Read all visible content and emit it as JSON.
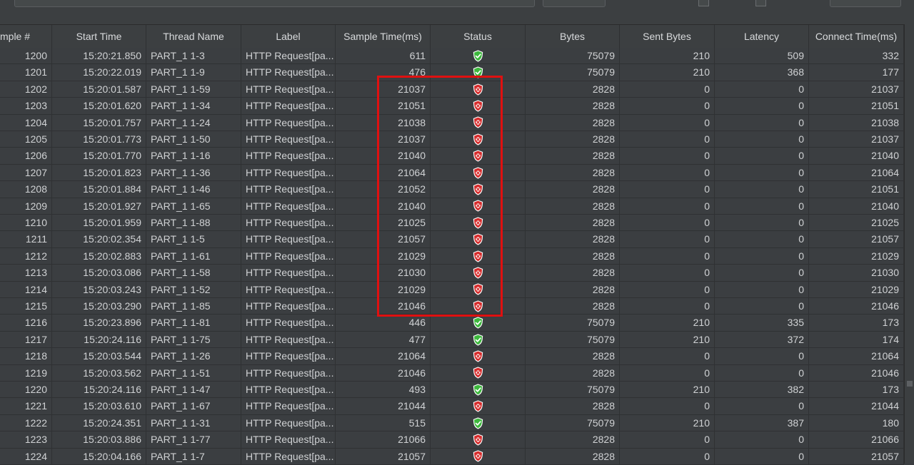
{
  "columns": [
    "mple #",
    "Start Time",
    "Thread Name",
    "Label",
    "Sample Time(ms)",
    "Status",
    "Bytes",
    "Sent Bytes",
    "Latency",
    "Connect Time(ms)"
  ],
  "colors": {
    "success": "#3db83d",
    "error": "#d62b2b",
    "highlight": "#e01010"
  },
  "rows": [
    {
      "sample": "1200",
      "start": "15:20:21.850",
      "thread": "PART_1 1-3",
      "label": "HTTP Request[pa...",
      "time": "611",
      "status": "success",
      "bytes": "75079",
      "sent": "210",
      "latency": "509",
      "connect": "332"
    },
    {
      "sample": "1201",
      "start": "15:20:22.019",
      "thread": "PART_1 1-9",
      "label": "HTTP Request[pa...",
      "time": "476",
      "status": "success",
      "bytes": "75079",
      "sent": "210",
      "latency": "368",
      "connect": "177"
    },
    {
      "sample": "1202",
      "start": "15:20:01.587",
      "thread": "PART_1 1-59",
      "label": "HTTP Request[pa...",
      "time": "21037",
      "status": "error",
      "bytes": "2828",
      "sent": "0",
      "latency": "0",
      "connect": "21037"
    },
    {
      "sample": "1203",
      "start": "15:20:01.620",
      "thread": "PART_1 1-34",
      "label": "HTTP Request[pa...",
      "time": "21051",
      "status": "error",
      "bytes": "2828",
      "sent": "0",
      "latency": "0",
      "connect": "21051"
    },
    {
      "sample": "1204",
      "start": "15:20:01.757",
      "thread": "PART_1 1-24",
      "label": "HTTP Request[pa...",
      "time": "21038",
      "status": "error",
      "bytes": "2828",
      "sent": "0",
      "latency": "0",
      "connect": "21038"
    },
    {
      "sample": "1205",
      "start": "15:20:01.773",
      "thread": "PART_1 1-50",
      "label": "HTTP Request[pa...",
      "time": "21037",
      "status": "error",
      "bytes": "2828",
      "sent": "0",
      "latency": "0",
      "connect": "21037"
    },
    {
      "sample": "1206",
      "start": "15:20:01.770",
      "thread": "PART_1 1-16",
      "label": "HTTP Request[pa...",
      "time": "21040",
      "status": "error",
      "bytes": "2828",
      "sent": "0",
      "latency": "0",
      "connect": "21040"
    },
    {
      "sample": "1207",
      "start": "15:20:01.823",
      "thread": "PART_1 1-36",
      "label": "HTTP Request[pa...",
      "time": "21064",
      "status": "error",
      "bytes": "2828",
      "sent": "0",
      "latency": "0",
      "connect": "21064"
    },
    {
      "sample": "1208",
      "start": "15:20:01.884",
      "thread": "PART_1 1-46",
      "label": "HTTP Request[pa...",
      "time": "21052",
      "status": "error",
      "bytes": "2828",
      "sent": "0",
      "latency": "0",
      "connect": "21051"
    },
    {
      "sample": "1209",
      "start": "15:20:01.927",
      "thread": "PART_1 1-65",
      "label": "HTTP Request[pa...",
      "time": "21040",
      "status": "error",
      "bytes": "2828",
      "sent": "0",
      "latency": "0",
      "connect": "21040"
    },
    {
      "sample": "1210",
      "start": "15:20:01.959",
      "thread": "PART_1 1-88",
      "label": "HTTP Request[pa...",
      "time": "21025",
      "status": "error",
      "bytes": "2828",
      "sent": "0",
      "latency": "0",
      "connect": "21025"
    },
    {
      "sample": "1211",
      "start": "15:20:02.354",
      "thread": "PART_1 1-5",
      "label": "HTTP Request[pa...",
      "time": "21057",
      "status": "error",
      "bytes": "2828",
      "sent": "0",
      "latency": "0",
      "connect": "21057"
    },
    {
      "sample": "1212",
      "start": "15:20:02.883",
      "thread": "PART_1 1-61",
      "label": "HTTP Request[pa...",
      "time": "21029",
      "status": "error",
      "bytes": "2828",
      "sent": "0",
      "latency": "0",
      "connect": "21029"
    },
    {
      "sample": "1213",
      "start": "15:20:03.086",
      "thread": "PART_1 1-58",
      "label": "HTTP Request[pa...",
      "time": "21030",
      "status": "error",
      "bytes": "2828",
      "sent": "0",
      "latency": "0",
      "connect": "21030"
    },
    {
      "sample": "1214",
      "start": "15:20:03.243",
      "thread": "PART_1 1-52",
      "label": "HTTP Request[pa...",
      "time": "21029",
      "status": "error",
      "bytes": "2828",
      "sent": "0",
      "latency": "0",
      "connect": "21029"
    },
    {
      "sample": "1215",
      "start": "15:20:03.290",
      "thread": "PART_1 1-85",
      "label": "HTTP Request[pa...",
      "time": "21046",
      "status": "error",
      "bytes": "2828",
      "sent": "0",
      "latency": "0",
      "connect": "21046"
    },
    {
      "sample": "1216",
      "start": "15:20:23.896",
      "thread": "PART_1 1-81",
      "label": "HTTP Request[pa...",
      "time": "446",
      "status": "success",
      "bytes": "75079",
      "sent": "210",
      "latency": "335",
      "connect": "173"
    },
    {
      "sample": "1217",
      "start": "15:20:24.116",
      "thread": "PART_1 1-75",
      "label": "HTTP Request[pa...",
      "time": "477",
      "status": "success",
      "bytes": "75079",
      "sent": "210",
      "latency": "372",
      "connect": "174"
    },
    {
      "sample": "1218",
      "start": "15:20:03.544",
      "thread": "PART_1 1-26",
      "label": "HTTP Request[pa...",
      "time": "21064",
      "status": "error",
      "bytes": "2828",
      "sent": "0",
      "latency": "0",
      "connect": "21064"
    },
    {
      "sample": "1219",
      "start": "15:20:03.562",
      "thread": "PART_1 1-51",
      "label": "HTTP Request[pa...",
      "time": "21046",
      "status": "error",
      "bytes": "2828",
      "sent": "0",
      "latency": "0",
      "connect": "21046"
    },
    {
      "sample": "1220",
      "start": "15:20:24.116",
      "thread": "PART_1 1-47",
      "label": "HTTP Request[pa...",
      "time": "493",
      "status": "success",
      "bytes": "75079",
      "sent": "210",
      "latency": "382",
      "connect": "173"
    },
    {
      "sample": "1221",
      "start": "15:20:03.610",
      "thread": "PART_1 1-67",
      "label": "HTTP Request[pa...",
      "time": "21044",
      "status": "error",
      "bytes": "2828",
      "sent": "0",
      "latency": "0",
      "connect": "21044"
    },
    {
      "sample": "1222",
      "start": "15:20:24.351",
      "thread": "PART_1 1-31",
      "label": "HTTP Request[pa...",
      "time": "515",
      "status": "success",
      "bytes": "75079",
      "sent": "210",
      "latency": "387",
      "connect": "180"
    },
    {
      "sample": "1223",
      "start": "15:20:03.886",
      "thread": "PART_1 1-77",
      "label": "HTTP Request[pa...",
      "time": "21066",
      "status": "error",
      "bytes": "2828",
      "sent": "0",
      "latency": "0",
      "connect": "21066"
    },
    {
      "sample": "1224",
      "start": "15:20:04.166",
      "thread": "PART_1 1-7",
      "label": "HTTP Request[pa...",
      "time": "21057",
      "status": "error",
      "bytes": "2828",
      "sent": "0",
      "latency": "0",
      "connect": "21057"
    }
  ]
}
